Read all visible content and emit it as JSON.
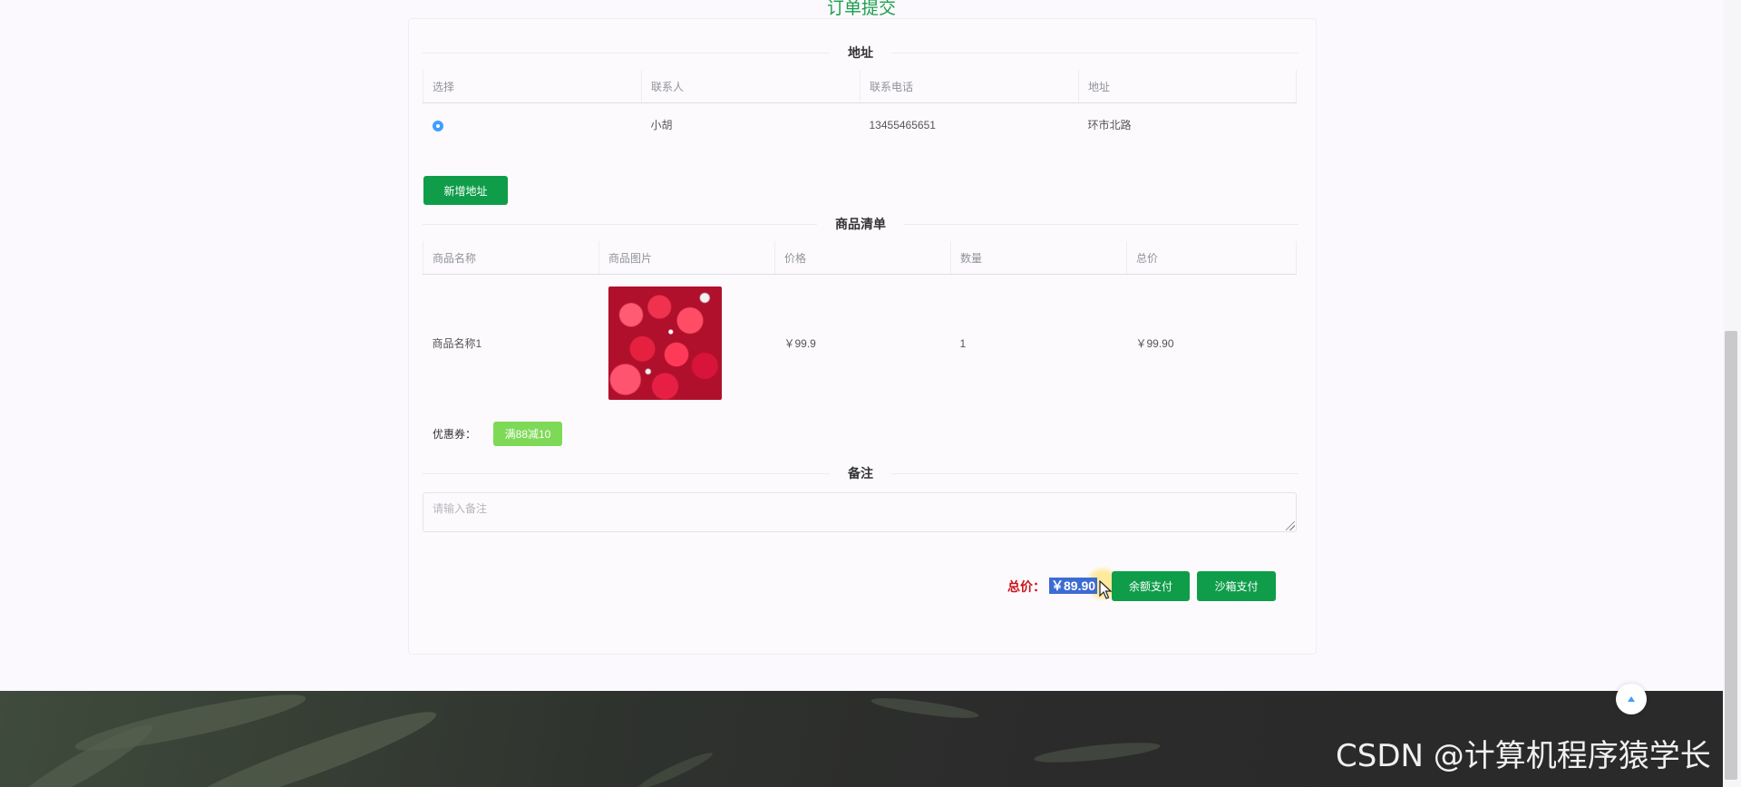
{
  "page": {
    "title": "订单提交"
  },
  "address": {
    "section_title": "地址",
    "headers": [
      "选择",
      "联系人",
      "联系电话",
      "地址"
    ],
    "rows": [
      {
        "contact": "小胡",
        "phone": "13455465651",
        "address": "环市北路"
      }
    ],
    "add_button": "新增地址"
  },
  "goods": {
    "section_title": "商品清单",
    "headers": [
      "商品名称",
      "商品图片",
      "价格",
      "数量",
      "总价"
    ],
    "rows": [
      {
        "name": "商品名称1",
        "price": "￥99.9",
        "quantity": "1",
        "total": "￥99.90"
      }
    ]
  },
  "coupon": {
    "label": "优惠券：",
    "tag": "满88减10",
    "tag_color": "#7ed957"
  },
  "remark": {
    "section_title": "备注",
    "placeholder": "请输入备注"
  },
  "payment": {
    "total_label": "总价：",
    "total_value": "￥89.90",
    "balance_button": "余额支付",
    "sandbox_button": "沙箱支付"
  },
  "watermark": "CSDN @计算机程序猿学长",
  "colors": {
    "accent": "#0f9d4a",
    "title": "#1b9f4c",
    "price": "#c8161d"
  },
  "icons": {
    "scroll_top": "chevron-up-icon",
    "radio": "radio-checked-icon",
    "cursor": "cursor-arrow-icon"
  }
}
